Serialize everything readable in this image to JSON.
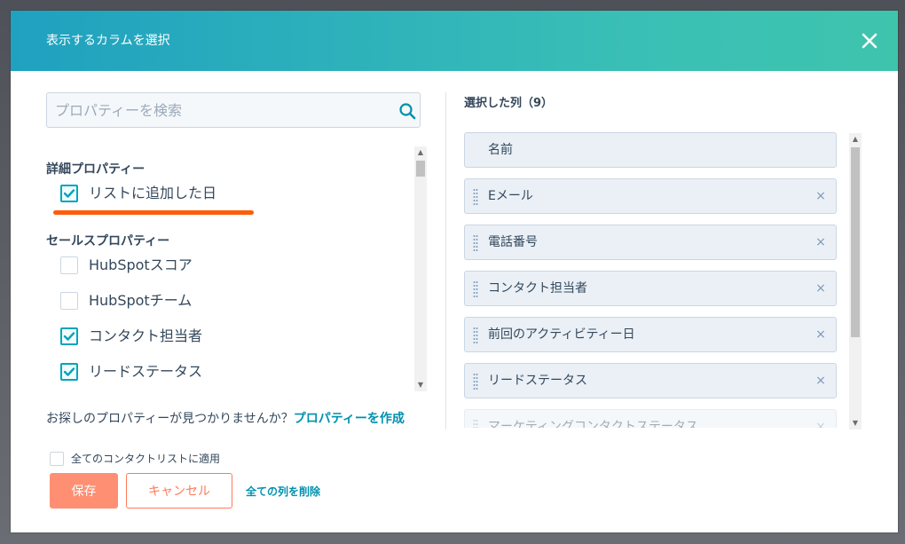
{
  "modal": {
    "title": "表示するカラムを選択"
  },
  "search": {
    "placeholder": "プロパティーを検索"
  },
  "groups": [
    {
      "title": "詳細プロパティー",
      "items": [
        {
          "label": "リストに追加した日",
          "checked": true
        }
      ]
    },
    {
      "title": "セールスプロパティー",
      "items": [
        {
          "label": "HubSpotスコア",
          "checked": false
        },
        {
          "label": "HubSpotチーム",
          "checked": false
        },
        {
          "label": "コンタクト担当者",
          "checked": true
        },
        {
          "label": "リードステータス",
          "checked": true
        }
      ]
    }
  ],
  "not_found": {
    "text": "お探しのプロパティーが見つかりませんか？",
    "link": "プロパティーを作成"
  },
  "selected": {
    "title": "選択した列（9）",
    "items": [
      {
        "label": "名前",
        "removable": false
      },
      {
        "label": "Eメール",
        "removable": true
      },
      {
        "label": "電話番号",
        "removable": true
      },
      {
        "label": "コンタクト担当者",
        "removable": true
      },
      {
        "label": "前回のアクティビティー日",
        "removable": true
      },
      {
        "label": "リードステータス",
        "removable": true
      },
      {
        "label": "マーケティングコンタクトステータス",
        "removable": true
      }
    ]
  },
  "footer": {
    "apply_all_label": "全てのコンタクトリストに適用",
    "save_label": "保存",
    "cancel_label": "キャンセル",
    "delete_all_label": "全ての列を削除"
  },
  "icons": {
    "close": "close-icon",
    "search": "search-icon",
    "check": "check-icon",
    "drag": "drag-handle-icon",
    "remove": "×"
  },
  "colors": {
    "header_start": "#1fa1c0",
    "header_end": "#3ec4ad",
    "accent": "#00a4bd",
    "link": "#0091ae",
    "primary_button": "#ff8f73",
    "cancel_border": "#ff7a59",
    "highlight": "#ff5c0b"
  }
}
